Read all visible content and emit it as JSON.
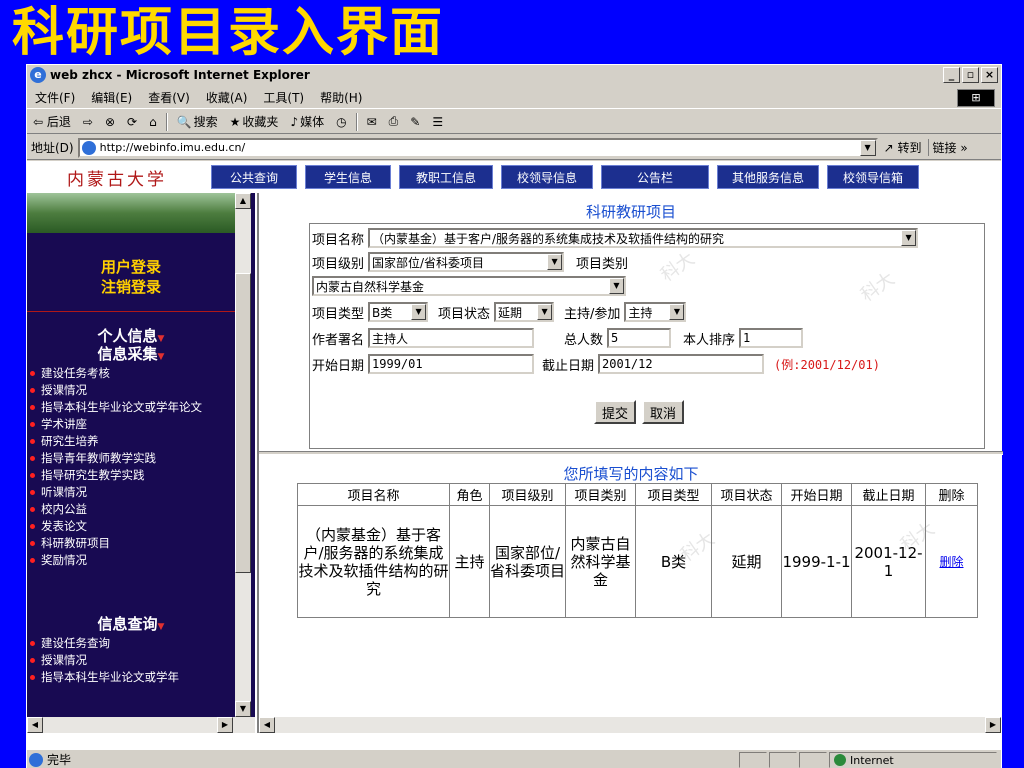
{
  "slide": {
    "title": "科研项目录入界面"
  },
  "window": {
    "title": "web zhcx - Microsoft Internet Explorer",
    "buttons": [
      "_",
      "▫",
      "×"
    ]
  },
  "menu": [
    "文件(F)",
    "编辑(E)",
    "查看(V)",
    "收藏(A)",
    "工具(T)",
    "帮助(H)"
  ],
  "toolbar": {
    "back": "⇦ 后退",
    "forward": "⇨",
    "stop": "⊗",
    "refresh": "⟳",
    "home": "⌂",
    "search": "搜索",
    "favorites": "收藏夹",
    "media": "媒体",
    "history": "◷"
  },
  "address": {
    "label": "地址(D)",
    "url": "http://webinfo.imu.edu.cn/",
    "go": "转到",
    "links": "链接 »"
  },
  "site": {
    "university": "内蒙古大学",
    "nav": [
      "公共查询",
      "学生信息",
      "教职工信息",
      "校领导信息",
      "公告栏",
      "其他服务信息",
      "校领导信箱"
    ]
  },
  "sidebar": {
    "login": "用户登录",
    "logout": "注销登录",
    "personal_head": "个人信息",
    "collect_head": "信息采集",
    "collect_items": [
      "建设任务考核",
      "授课情况",
      "指导本科生毕业论文或学年论文",
      "学术讲座",
      "研究生培养",
      "指导青年教师教学实践",
      "指导研究生教学实践",
      "听课情况",
      "校内公益",
      "发表论文",
      "科研教研项目",
      "奖励情况"
    ],
    "query_head": "信息查询",
    "query_items": [
      "建设任务查询",
      "授课情况",
      "指导本科生毕业论文或学年"
    ]
  },
  "form": {
    "title": "科研教研项目",
    "name_label": "项目名称",
    "name_value": "（内蒙基金）基于客户/服务器的系统集成技术及软插件结构的研究",
    "level_label": "项目级别",
    "level_value": "国家部位/省科委项目",
    "category_label": "项目类别",
    "category_value": "内蒙古自然科学基金",
    "type_label": "项目类型",
    "type_value": "B类",
    "status_label": "项目状态",
    "status_value": "延期",
    "role_label": "主持/参加",
    "role_value": "主持",
    "author_label": "作者署名",
    "author_value": "主持人",
    "total_label": "总人数",
    "total_value": "5",
    "rank_label": "本人排序",
    "rank_value": "1",
    "start_label": "开始日期",
    "start_value": "1999/01",
    "end_label": "截止日期",
    "end_value": "2001/12",
    "hint": "(例:2001/12/01)",
    "submit": "提交",
    "cancel": "取消"
  },
  "result": {
    "title": "您所填写的内容如下",
    "headers": [
      "项目名称",
      "角色",
      "项目级别",
      "项目类别",
      "项目类型",
      "项目状态",
      "开始日期",
      "截止日期",
      "删除"
    ],
    "row": [
      "（内蒙基金）基于客户/服务器的系统集成技术及软插件结构的研究",
      "主持",
      "国家部位/省科委项目",
      "内蒙古自然科学基金",
      "B类",
      "延期",
      "1999-1-1",
      "2001-12-1",
      "删除"
    ]
  },
  "status": {
    "text": "完毕",
    "zone": "Internet"
  },
  "watermark": "科大"
}
